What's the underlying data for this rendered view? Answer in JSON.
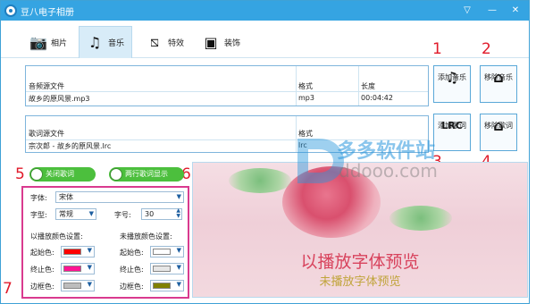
{
  "window": {
    "title": "豆八电子相册"
  },
  "tabs": [
    {
      "label": "相片",
      "icon": "camera-icon"
    },
    {
      "label": "音乐",
      "icon": "music-note-icon"
    },
    {
      "label": "特效",
      "icon": "effects-icon"
    },
    {
      "label": "装饰",
      "icon": "picture-icon"
    }
  ],
  "music_grid": {
    "headers": [
      "音频源文件",
      "格式",
      "长度"
    ],
    "row": [
      "故乡的原风景.mp3",
      "mp3",
      "00:04:42"
    ]
  },
  "lyrics_grid": {
    "headers": [
      "歌词源文件",
      "格式"
    ],
    "row": [
      "宗次郎 - 故乡的原风景.lrc",
      "lrc"
    ]
  },
  "buttons": {
    "add_music": "添加音乐",
    "remove_music": "移除音乐",
    "add_lyrics": "添加歌词",
    "remove_lyrics": "移除歌词",
    "lrc_icon_text": "LRC"
  },
  "annotations": [
    "1",
    "2",
    "3",
    "4",
    "5",
    "6",
    "7"
  ],
  "toggles": {
    "close_lyrics": "关闭歌词",
    "two_line": "两行歌词显示"
  },
  "settings": {
    "font_label": "字体:",
    "font_value": "宋体",
    "style_label": "字型:",
    "style_value": "常规",
    "size_label": "字号:",
    "size_value": "30",
    "played_heading": "以播放颜色设置:",
    "unplayed_heading": "未播放颜色设置:",
    "start_color_label": "起始色:",
    "end_color_label": "终止色:",
    "border_color_label": "边框色:",
    "played_colors": {
      "start": "#ff0000",
      "end": "#ff1493",
      "border": "#bdbdbd"
    },
    "unplayed_colors": {
      "start": "#ffffff",
      "end": "#e6e6e6",
      "border": "#808000"
    }
  },
  "preview": {
    "played_text": "以播放字体预览",
    "unplayed_text": "未播放字体预览"
  },
  "watermark": {
    "text": "多多软件站",
    "url": "ddooo.com"
  }
}
